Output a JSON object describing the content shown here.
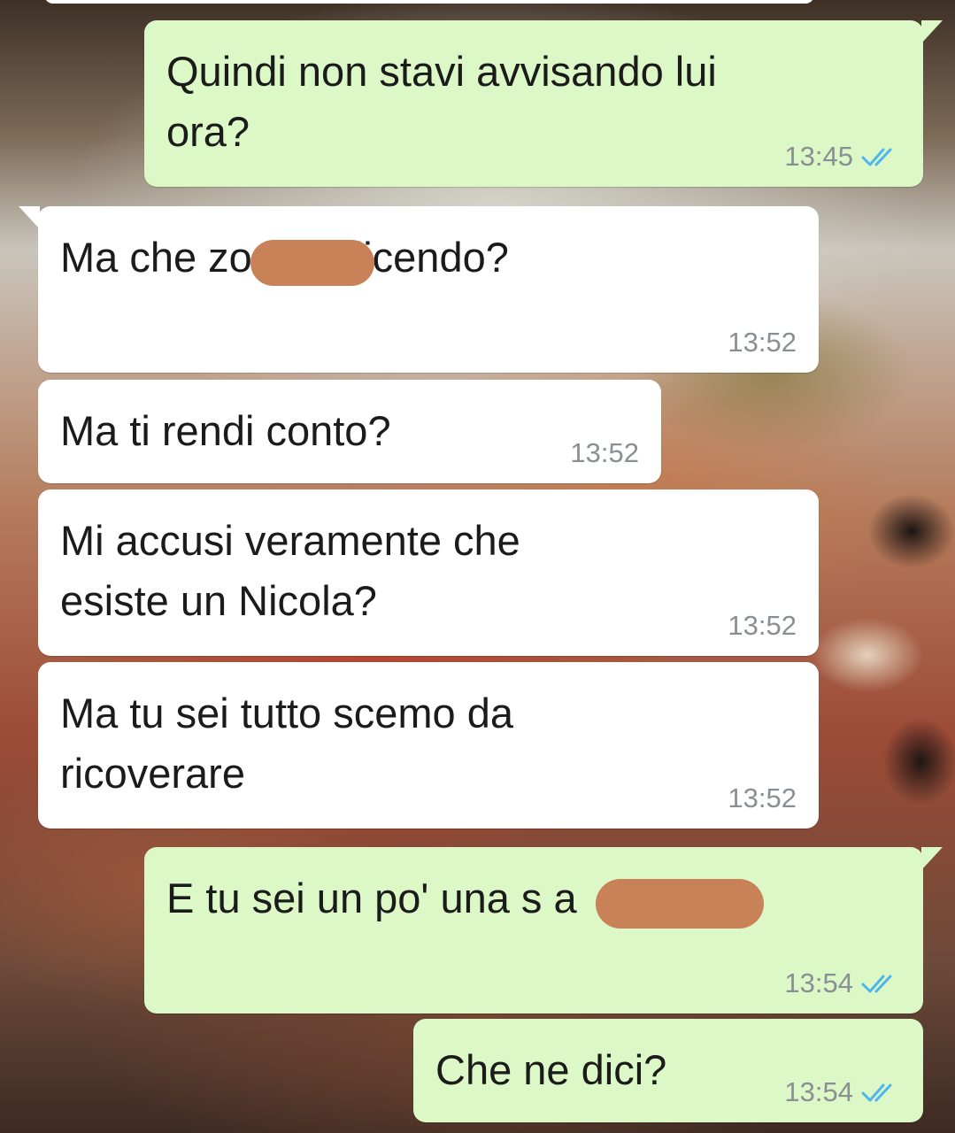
{
  "chat": {
    "messages": [
      {
        "direction": "out",
        "text": "Quindi non stavi avvisando lui\nora?",
        "time": "13:45",
        "status": "read"
      },
      {
        "direction": "in",
        "text": "Ma che        zo stai dicendo?",
        "time": "13:52"
      },
      {
        "direction": "in",
        "text": "Ma ti rendi conto?",
        "time": "13:52"
      },
      {
        "direction": "in",
        "text": "Mi accusi veramente che\nesiste un Nicola?",
        "time": "13:52"
      },
      {
        "direction": "in",
        "text": "Ma tu sei tutto scemo da\nricoverare",
        "time": "13:52"
      },
      {
        "direction": "out",
        "text": "E tu sei un po' una s          a",
        "time": "13:54",
        "status": "read"
      },
      {
        "direction": "out",
        "text": "Che ne dici?",
        "time": "13:54",
        "status": "read"
      }
    ]
  },
  "colors": {
    "outgoing_bubble": "#dcf8c6",
    "incoming_bubble": "#ffffff",
    "read_tick": "#4fb6ec",
    "timestamp": "#8a8f94",
    "redaction": "#c98157"
  },
  "icons": {
    "read_receipt": "double-check-icon"
  }
}
